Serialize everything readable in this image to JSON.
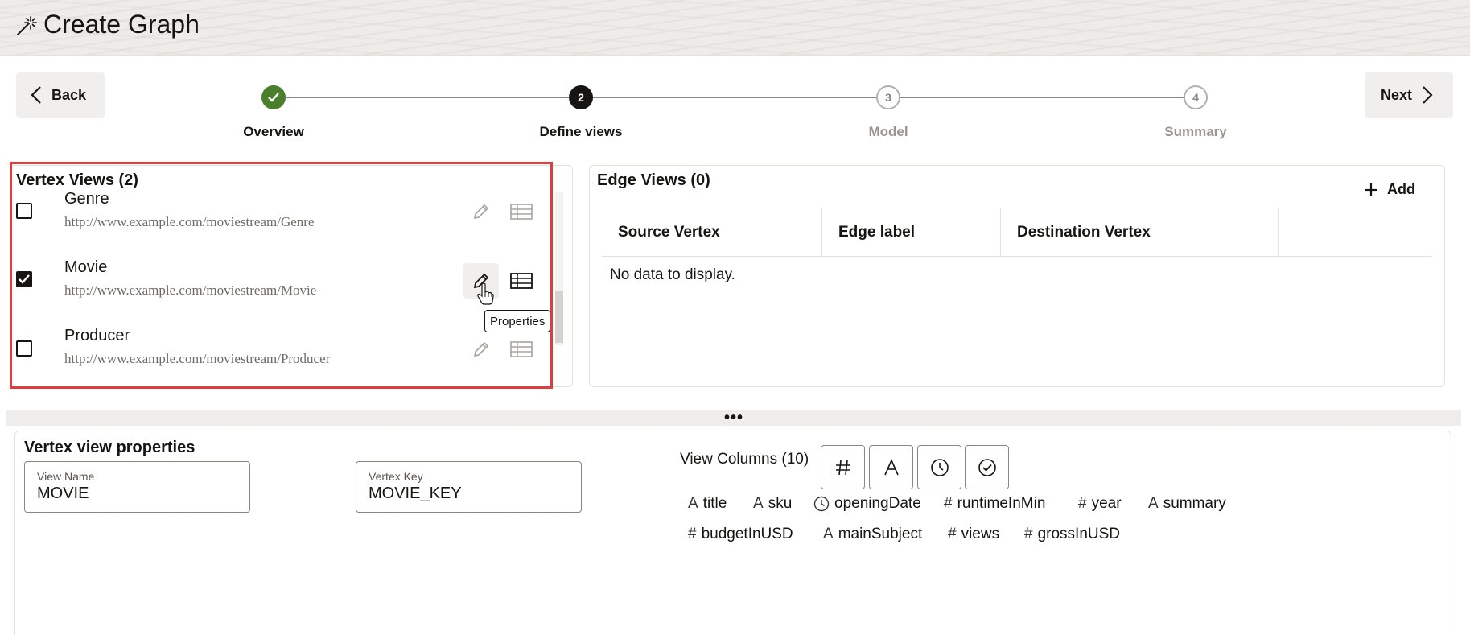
{
  "header": {
    "title": "Create Graph"
  },
  "nav": {
    "back_label": "Back",
    "next_label": "Next"
  },
  "stepper": {
    "steps": [
      {
        "number": "",
        "label": "Overview",
        "state": "done"
      },
      {
        "number": "2",
        "label": "Define views",
        "state": "current"
      },
      {
        "number": "3",
        "label": "Model",
        "state": "future"
      },
      {
        "number": "4",
        "label": "Summary",
        "state": "future"
      }
    ]
  },
  "vertex_views": {
    "title": "Vertex Views (2)",
    "items": [
      {
        "name": "Genre",
        "url": "http://www.example.com/moviestream/Genre",
        "checked": false
      },
      {
        "name": "Movie",
        "url": "http://www.example.com/moviestream/Movie",
        "checked": true
      },
      {
        "name": "Producer",
        "url": "http://www.example.com/moviestream/Producer",
        "checked": false
      }
    ],
    "tooltip": "Properties"
  },
  "edge_views": {
    "title": "Edge Views (0)",
    "add_label": "Add",
    "columns": [
      "Source Vertex",
      "Edge label",
      "Destination Vertex",
      ""
    ],
    "empty_text": "No data to display."
  },
  "splitter": {
    "dots": "•••"
  },
  "properties": {
    "title": "Vertex view properties",
    "view_name_label": "View Name",
    "view_name_value": "MOVIE",
    "vertex_key_label": "Vertex Key",
    "vertex_key_value": "MOVIE_KEY",
    "view_columns_label": "View Columns (10)",
    "type_filters": [
      "number-icon",
      "text-icon",
      "clock-icon",
      "check-circle-icon"
    ],
    "columns": [
      {
        "name": "title",
        "type": "text"
      },
      {
        "name": "sku",
        "type": "text"
      },
      {
        "name": "openingDate",
        "type": "date"
      },
      {
        "name": "runtimeInMin",
        "type": "number"
      },
      {
        "name": "year",
        "type": "number"
      },
      {
        "name": "summary",
        "type": "text"
      },
      {
        "name": "budgetInUSD",
        "type": "number"
      },
      {
        "name": "mainSubject",
        "type": "text"
      },
      {
        "name": "views",
        "type": "number"
      },
      {
        "name": "grossInUSD",
        "type": "number"
      }
    ]
  },
  "colors": {
    "highlight": "#e03e3e",
    "done_step": "#4b7f2d",
    "text": "#161513"
  }
}
